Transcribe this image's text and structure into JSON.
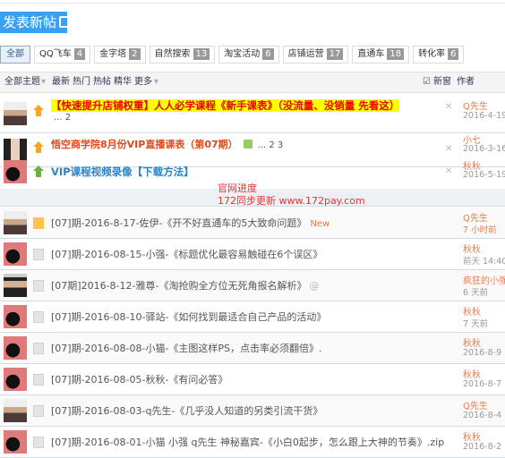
{
  "post_button": {
    "label": "发表新帖",
    "icon": "edit-icon"
  },
  "tabs": [
    {
      "label": "全部",
      "active": true
    },
    {
      "label": "QQ飞车",
      "count": "4"
    },
    {
      "label": "金字塔",
      "count": "2"
    },
    {
      "label": "自然搜索",
      "count": "13"
    },
    {
      "label": "淘宝活动",
      "count": "6"
    },
    {
      "label": "店铺运营",
      "count": "17"
    },
    {
      "label": "直通车",
      "count": "18"
    },
    {
      "label": "转化率",
      "count": "6"
    }
  ],
  "filter": {
    "all": "全部主题",
    "latest": "最新",
    "hot": "热门",
    "hotpost": "热帖",
    "digest": "精华",
    "more": "更多",
    "new_window": "新窗",
    "author": "作者"
  },
  "sticky": [
    {
      "title": "【快速提升店铺权重】人人必学课程《新手课表》（没流量、没销量 先看这）",
      "pages": "... 2",
      "author": "Q先生",
      "date": "2016-4-19"
    },
    {
      "title": "悟空商学院8月份VIP直播课表（第07期）",
      "pages": "... 2  3",
      "author": "小七",
      "date": "2016-3-16"
    },
    {
      "title": "VIP课程视频录像【下载方法】",
      "author": "秋秋",
      "date": "2016-5-19"
    }
  ],
  "watermark": {
    "line1": "官网进度",
    "line2": "172同步更新 www.172pay.com"
  },
  "threads": [
    {
      "title": "[07]期-2016-8-17-佐伊-《开不好直通车的5大致命问题》",
      "badge": "New",
      "author": "Q先生",
      "date": "7 小时前"
    },
    {
      "title": "[07]期-2016-08-15-小强-《标题优化最容易触碰在6个误区》",
      "author": "秋秋",
      "date": "前天 14:40"
    },
    {
      "title": "[07期]2016-8-12-雅尊-《淘抢购全方位无死角报名解析》",
      "author": "疯狂的小强",
      "date": "6 天前"
    },
    {
      "title": "[07]期-2016-08-10-驿站-《如何找到最适合自己产品的活动》",
      "author": "秋秋",
      "date": "7 天前"
    },
    {
      "title": "[07]期-2016-08-08-小猫-《主图这样PS，点击率必须翻倍》.",
      "author": "秋秋",
      "date": "2016-8-9"
    },
    {
      "title": "[07]期-2016-08-05-秋秋-《有问必答》",
      "author": "秋秋",
      "date": "2016-8-7"
    },
    {
      "title": "[07]期-2016-08-03-q先生-《几乎没人知道的另类引流干货》",
      "author": "Q先生",
      "date": "2016-8-4"
    },
    {
      "title": "[07]期-2016-08-01-小猫 小强 q先生 神秘嘉宾-《小白0起步，怎么跟上大神的节奏》.zip",
      "author": "秋秋",
      "date": "2016-8-2"
    }
  ]
}
